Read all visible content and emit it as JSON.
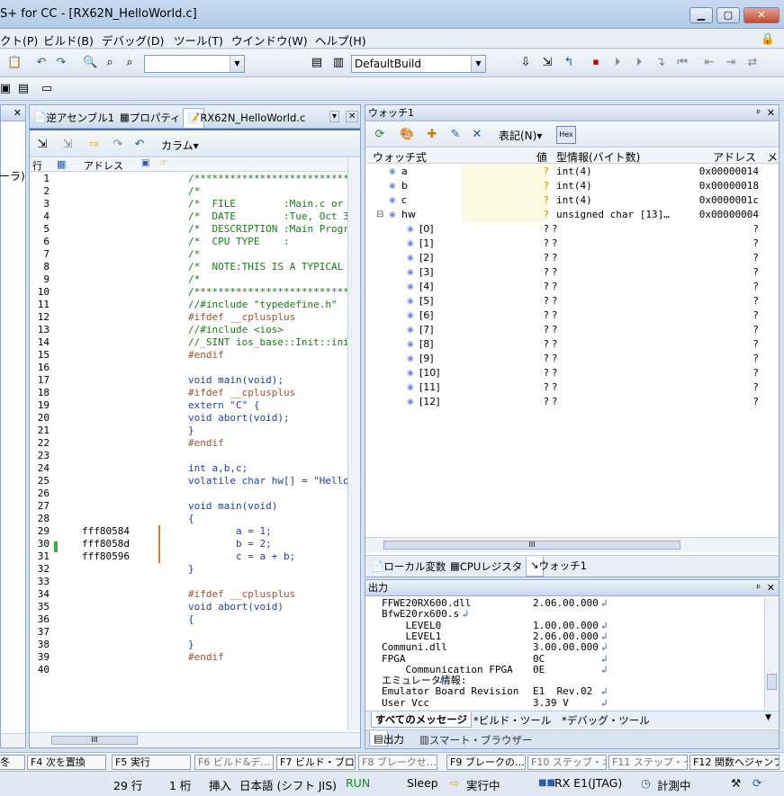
{
  "window": {
    "title": "S+ for CC - [RX62N_HelloWorld.c]",
    "min": "▁",
    "max": "▢",
    "close": "✕"
  },
  "menu": [
    "クト(P)",
    "ビルド(B)",
    "デバッグ(D)",
    "ツール(T)",
    "ウインドウ(W)",
    "ヘルプ(H)"
  ],
  "toolbar": {
    "build_config": "DefaultBuild"
  },
  "left_pane": {
    "text": "ーラ)",
    "close": "✕"
  },
  "editor": {
    "tabs": [
      "逆アセンブル1",
      "プロパティ",
      "RX62N_HelloWorld.c"
    ],
    "column_menu": "カラム▾",
    "header": {
      "line": "行",
      "address": "アドレス"
    },
    "lines": [
      "1",
      "2",
      "3",
      "4",
      "5",
      "6",
      "7",
      "8",
      "9",
      "10",
      "11",
      "12",
      "13",
      "14",
      "15",
      "16",
      "17",
      "18",
      "19",
      "20",
      "21",
      "22",
      "23",
      "24",
      "25",
      "26",
      "27",
      "28",
      "29",
      "30",
      "31",
      "32",
      "33",
      "34",
      "35",
      "36",
      "37",
      "38",
      "39",
      "40"
    ],
    "addresses": [
      {
        "line": 29,
        "addr": "fff80584"
      },
      {
        "line": 30,
        "addr": "fff8058d"
      },
      {
        "line": 31,
        "addr": "fff80596"
      }
    ],
    "code": [
      "/***************************",
      "/*",
      "/*  FILE        :Main.c or",
      "/*  DATE        :Tue, Oct 3",
      "/*  DESCRIPTION :Main Progr",
      "/*  CPU TYPE    :",
      "/*",
      "/*  NOTE:THIS IS A TYPICAL",
      "/*",
      "/***************************",
      "//#include \"typedefine.h\"",
      "#ifdef __cplusplus",
      "//#include <ios>",
      "//_SINT ios_base::Init::ini",
      "#endif",
      "",
      "void main(void);",
      "#ifdef __cplusplus",
      "extern \"C\" {",
      "void abort(void);",
      "}",
      "#endif",
      "",
      "int a,b,c;",
      "volatile char hw[] = \"Hello",
      "",
      "void main(void)",
      "{",
      "        a = 1;",
      "        b = 2;",
      "        c = a + b;",
      "}",
      "",
      "#ifdef __cplusplus",
      "void abort(void)",
      "{",
      "",
      "}",
      "#endif",
      ""
    ]
  },
  "watch": {
    "title": "ウォッチ1",
    "pin": "ᵖ",
    "close": "✕",
    "display_menu": "表記(N)▾",
    "hex": "Hex",
    "columns": [
      "ウォッチ式",
      "値",
      "型情報(バイト数)",
      "アドレス",
      "メ"
    ],
    "rows": [
      {
        "name": "a",
        "value": "?",
        "type": "int(4)",
        "addr": "0x00000014"
      },
      {
        "name": "b",
        "value": "?",
        "type": "int(4)",
        "addr": "0x00000018"
      },
      {
        "name": "c",
        "value": "?",
        "type": "int(4)",
        "addr": "0x0000001c"
      },
      {
        "name": "hw",
        "value": "?",
        "type": "unsigned char [13]…",
        "addr": "0x00000004"
      },
      {
        "name": "[0]",
        "value": "? ?",
        "type": "",
        "addr": "?"
      },
      {
        "name": "[1]",
        "value": "? ?",
        "type": "",
        "addr": "?"
      },
      {
        "name": "[2]",
        "value": "? ?",
        "type": "",
        "addr": "?"
      },
      {
        "name": "[3]",
        "value": "? ?",
        "type": "",
        "addr": "?"
      },
      {
        "name": "[4]",
        "value": "? ?",
        "type": "",
        "addr": "?"
      },
      {
        "name": "[5]",
        "value": "? ?",
        "type": "",
        "addr": "?"
      },
      {
        "name": "[6]",
        "value": "? ?",
        "type": "",
        "addr": "?"
      },
      {
        "name": "[7]",
        "value": "? ?",
        "type": "",
        "addr": "?"
      },
      {
        "name": "[8]",
        "value": "? ?",
        "type": "",
        "addr": "?"
      },
      {
        "name": "[9]",
        "value": "? ?",
        "type": "",
        "addr": "?"
      },
      {
        "name": "[10]",
        "value": "? ?",
        "type": "",
        "addr": "?"
      },
      {
        "name": "[11]",
        "value": "? ?",
        "type": "",
        "addr": "?"
      },
      {
        "name": "[12]",
        "value": "? ?",
        "type": "",
        "addr": "?"
      }
    ],
    "bottom_tabs": [
      "ローカル変数",
      "CPUレジスタ",
      "ウォッチ1"
    ]
  },
  "output": {
    "title": "出力",
    "pin": "ᵖ",
    "close": "✕",
    "lines": [
      [
        "FFWE20RX600.dll",
        "2.06.00.000"
      ],
      [
        "BfwE20rx600.s",
        ""
      ],
      [
        "    LEVEL0",
        "1.00.00.000"
      ],
      [
        "    LEVEL1",
        "2.06.00.000"
      ],
      [
        "Communi.dll",
        "3.00.00.000"
      ],
      [
        "FPGA",
        "0C"
      ],
      [
        "    Communication FPGA",
        "0E"
      ],
      [
        "エミュレータ情報:",
        ""
      ],
      [
        "Emulator Board Revision",
        "E1  Rev.02"
      ],
      [
        "User Vcc",
        "3.39 V"
      ]
    ],
    "tabs": [
      "すべてのメッセージ",
      "*ビルド・ツール",
      "*デバッグ・ツール"
    ],
    "bottom_tabs": [
      "出力",
      "スマート・ブラウザー"
    ]
  },
  "fkeys": [
    "冬",
    "F4 次を置換",
    "F5 実行",
    "F6 ビルド&デ…",
    "F7 ビルド・ブロ…",
    "F8 ブレークせ…",
    "F9 ブレークの…",
    "F10 ステップ・オ…",
    "F11 ステップ・イン",
    "F12 関数へジャンプ"
  ],
  "status": {
    "line": "29 行",
    "col": "1 桁",
    "mode": "挿入",
    "encoding": "日本語 (シフト JIS)",
    "run": "RUN",
    "sleep": "Sleep",
    "exec": "実行中",
    "target": "RX E1(JTAG)",
    "measure": "計測中"
  }
}
